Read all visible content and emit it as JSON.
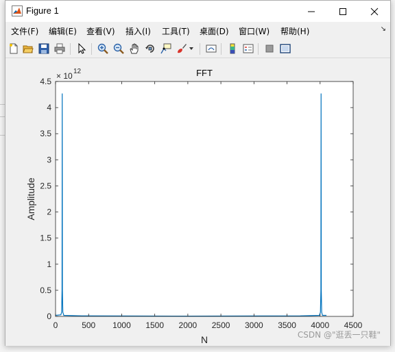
{
  "window": {
    "title": "Figure 1"
  },
  "menu": [
    {
      "label": "文件(F)"
    },
    {
      "label": "编辑(E)"
    },
    {
      "label": "查看(V)"
    },
    {
      "label": "插入(I)"
    },
    {
      "label": "工具(T)"
    },
    {
      "label": "桌面(D)"
    },
    {
      "label": "窗口(W)"
    },
    {
      "label": "帮助(H)"
    }
  ],
  "toolbar": {
    "icons": [
      "new-figure-icon",
      "open-file-icon",
      "save-icon",
      "print-icon",
      "pointer-icon",
      "zoom-in-icon",
      "zoom-out-icon",
      "pan-hand-icon",
      "rotate-3d-icon",
      "data-cursor-icon",
      "brush-icon",
      "link-plot-icon",
      "colorbar-icon",
      "legend-icon",
      "hide-plot-tools-icon",
      "show-plot-tools-icon"
    ]
  },
  "colors": {
    "line": "#0072bd",
    "axes_bg": "#ffffff",
    "figure_bg": "#f0f0f0"
  },
  "chart_data": {
    "type": "line",
    "title": "FFT",
    "xlabel": "N",
    "ylabel": "Amplitude",
    "exponent_label": "× 10",
    "exponent_power": "12",
    "xlim": [
      0,
      4500
    ],
    "ylim": [
      0,
      4500000000000.0
    ],
    "xticks": [
      "0",
      "500",
      "1000",
      "1500",
      "2000",
      "2500",
      "3000",
      "3500",
      "4000",
      "4500"
    ],
    "yticks": [
      "0",
      "0.5",
      "1",
      "1.5",
      "2",
      "2.5",
      "3",
      "3.5",
      "4",
      "4.5"
    ],
    "grid": false,
    "x": [
      0,
      80,
      92,
      98,
      101,
      104,
      110,
      125,
      400,
      2000,
      3700,
      3990,
      4005,
      4012,
      4015,
      4018,
      4024,
      4036,
      4096
    ],
    "y": [
      20000000000.0,
      30000000000.0,
      80000000000.0,
      500000000000.0,
      4270000000000.0,
      500000000000.0,
      80000000000.0,
      20000000000.0,
      10000000000.0,
      5000000000.0,
      10000000000.0,
      20000000000.0,
      80000000000.0,
      500000000000.0,
      4270000000000.0,
      500000000000.0,
      80000000000.0,
      20000000000.0,
      20000000000.0
    ]
  },
  "watermark": "CSDN @\"逛丢一只鞋\""
}
